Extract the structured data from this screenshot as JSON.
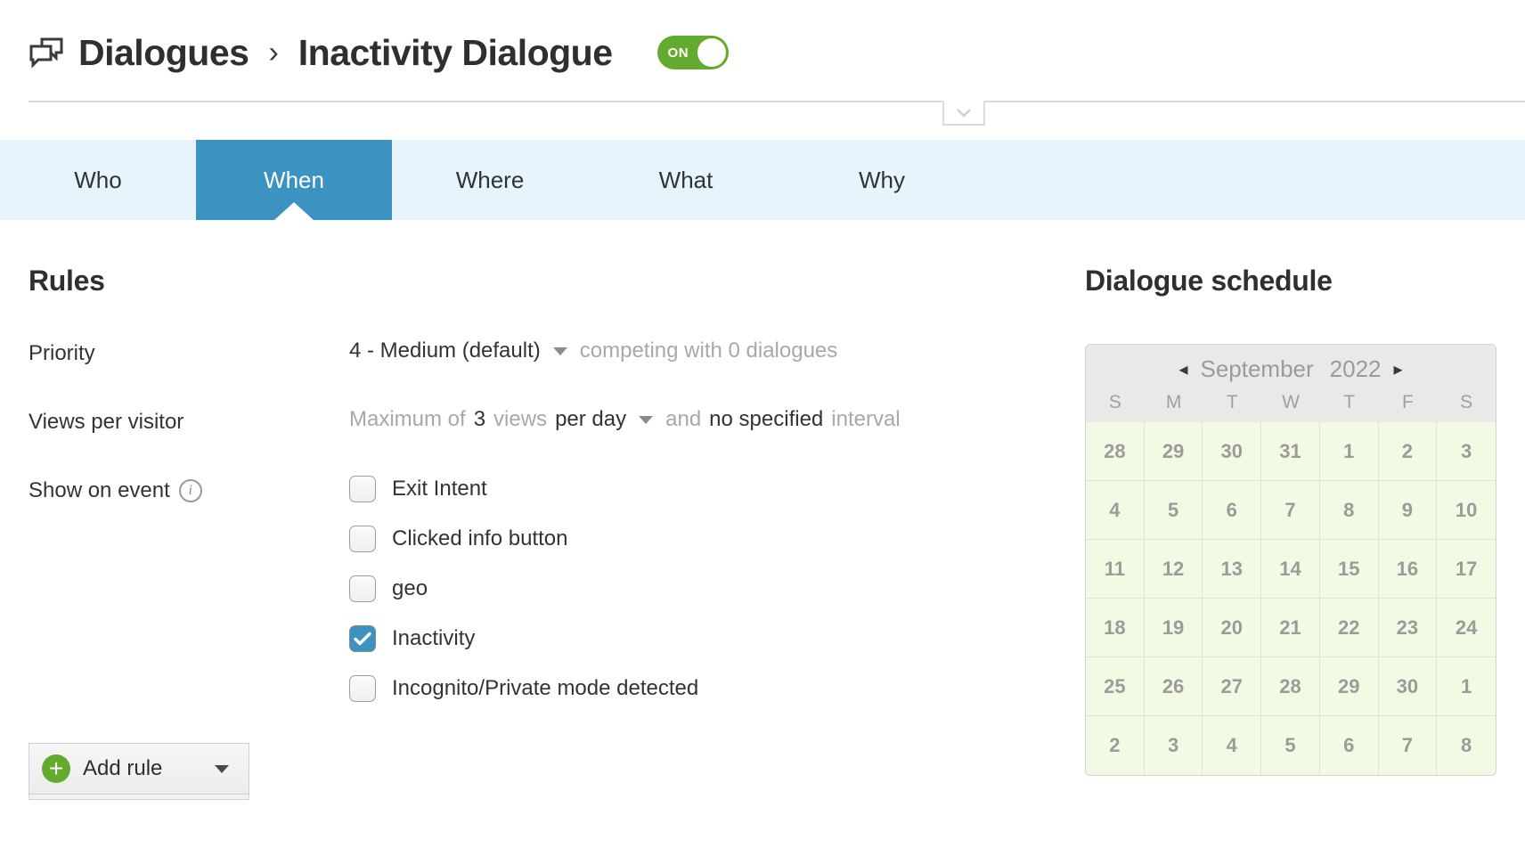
{
  "header": {
    "icon": "dialogues-icon",
    "breadcrumb_root": "Dialogues",
    "breadcrumb_separator": "›",
    "breadcrumb_current": "Inactivity Dialogue",
    "toggle_label": "ON",
    "toggle_state": "on",
    "toggle_color": "#62ab2f",
    "collapse_icon": "chevron-down-icon"
  },
  "tabs": [
    {
      "label": "Who",
      "active": false
    },
    {
      "label": "When",
      "active": true
    },
    {
      "label": "Where",
      "active": false
    },
    {
      "label": "What",
      "active": false
    },
    {
      "label": "Why",
      "active": false
    }
  ],
  "tabs_style": {
    "bar_bg": "#e6f4fb",
    "active_bg": "#3c92c0",
    "active_fg": "#ffffff"
  },
  "rules": {
    "title": "Rules",
    "priority": {
      "label": "Priority",
      "value": "4 - Medium (default)",
      "dropdown_icon": "caret-down-icon",
      "suffix": "competing with 0 dialogues"
    },
    "views_per_visitor": {
      "label": "Views per visitor",
      "prefix": "Maximum of",
      "count": "3",
      "unit": "views",
      "frequency": "per day",
      "dropdown_icon": "caret-down-icon",
      "conjunction": "and",
      "interval_value": "no specified",
      "interval_unit": "interval"
    },
    "show_on_event": {
      "label": "Show on event",
      "info_icon": "info-icon",
      "options": [
        {
          "label": "Exit Intent",
          "checked": false
        },
        {
          "label": "Clicked info button",
          "checked": false
        },
        {
          "label": "geo",
          "checked": false
        },
        {
          "label": "Inactivity",
          "checked": true
        },
        {
          "label": "Incognito/Private mode detected",
          "checked": false
        }
      ]
    },
    "add_rule": {
      "label": "Add rule",
      "plus_icon": "plus-icon",
      "dropdown_icon": "caret-down-icon"
    }
  },
  "schedule": {
    "title": "Dialogue schedule",
    "prev_icon": "◂",
    "next_icon": "▸",
    "month": "September",
    "year": "2022",
    "day_headers": [
      "S",
      "M",
      "T",
      "W",
      "T",
      "F",
      "S"
    ],
    "weeks": [
      [
        "28",
        "29",
        "30",
        "31",
        "1",
        "2",
        "3"
      ],
      [
        "4",
        "5",
        "6",
        "7",
        "8",
        "9",
        "10"
      ],
      [
        "11",
        "12",
        "13",
        "14",
        "15",
        "16",
        "17"
      ],
      [
        "18",
        "19",
        "20",
        "21",
        "22",
        "23",
        "24"
      ],
      [
        "25",
        "26",
        "27",
        "28",
        "29",
        "30",
        "1"
      ],
      [
        "2",
        "3",
        "4",
        "5",
        "6",
        "7",
        "8"
      ]
    ],
    "cell_bg": "#f3fae3",
    "header_bg": "#e9e9e9"
  }
}
